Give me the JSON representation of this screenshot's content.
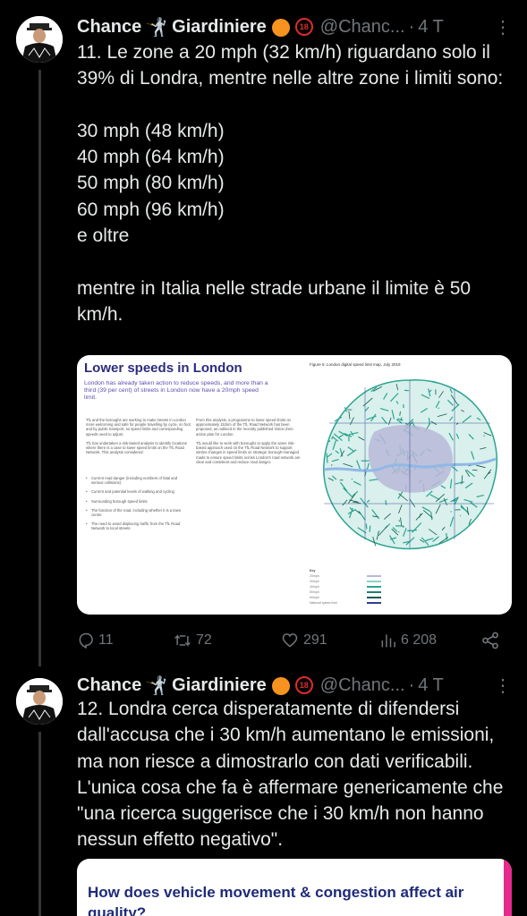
{
  "tweets": [
    {
      "author_name": "Chance",
      "author_name2": "Giardiniere",
      "handle": "@Chanc...",
      "dot": "·",
      "time": "4 T",
      "more": "⋮",
      "text": "11. Le zone a 20 mph (32 km/h) riguardano solo il 39% di Londra, mentre nelle altre zone i limiti sono:\n\n30 mph (48 km/h)\n40 mph (64 km/h)\n50 mph (80 km/h)\n60 mph (96 km/h)\ne oltre\n\nmentre in Italia nelle strade urbane il limite è 50 km/h.",
      "actions": {
        "replies": "11",
        "reposts": "72",
        "likes": "291",
        "views": "6 208"
      }
    },
    {
      "author_name": "Chance",
      "author_name2": "Giardiniere",
      "handle": "@Chanc...",
      "dot": "·",
      "time": "4 T",
      "more": "⋮",
      "text": "12. Londra cerca disperatamente di difendersi dall'accusa che i 30 km/h aumentano le emissioni, ma non riesce a dimostrarlo con dati verificabili. L'unica cosa che fa è affermare genericamente che \"una ricerca suggerisce che i 30 km/h non hanno nessun effetto negativo\"."
    }
  ],
  "card1": {
    "title": "Lower speeds in London",
    "intro": "London has already taken action to reduce speeds, and more than a third (39 per cent) of streets in London now have a 20mph speed limit.",
    "col1": "TfL and the boroughs are working to make streets in London more welcoming and safe for people travelling by cycle, on foot and by public transport, so speed limits and corresponding speeds need to adjust.\n\nTfL has undertaken a risk-based analysis to identify locations where there is a case to lower speed limits on the TfL Road Network. This analysis considered:",
    "col2": "From this analysis, a programme to lower speed limits on approximately 151km of the TfL Road Network has been proposed, as outlined in the recently published Vision Zero action plan for London.\n\nTfL would like to work with boroughs to apply the same risk-based approach used on the TfL Road Network to support similar changes in speed limits on strategic borough-managed roads to ensure speed limits across London's road network are clear and consistent and reduce road danger.",
    "bullets": [
      "Current road danger (including numbers of fatal and serious collisions)",
      "Current and potential levels of walking and cycling",
      "Surrounding borough speed limits",
      "The function of the road, including whether it is a town centre",
      "The need to avoid displacing traffic from the TfL Road Network to local streets"
    ],
    "figure_title": "Figure 5: London digital speed limit map, July 2019",
    "legend_title": "Key",
    "legend": [
      "20mph",
      "30mph",
      "40mph",
      "50mph",
      "60mph",
      "National speed limit"
    ],
    "legend_colors": [
      "#b7b8d8",
      "#8fd3c3",
      "#2aa58f",
      "#20806e",
      "#0e5b4d",
      "#2c3e91"
    ]
  },
  "card2": {
    "title": "How does vehicle movement & congestion affect air quality?"
  },
  "icons": {
    "reply": "reply-icon",
    "repost": "repost-icon",
    "like": "heart-icon",
    "views": "views-icon",
    "share": "share-icon",
    "more": "more-icon",
    "orange": "orange-emoji",
    "fencer": "fencer-emoji",
    "no-under-18": "no-under-18-emoji"
  },
  "colors": {
    "background": "#000000",
    "text": "#e7e9ea",
    "secondary": "#71767b",
    "thread_line": "#333639"
  }
}
